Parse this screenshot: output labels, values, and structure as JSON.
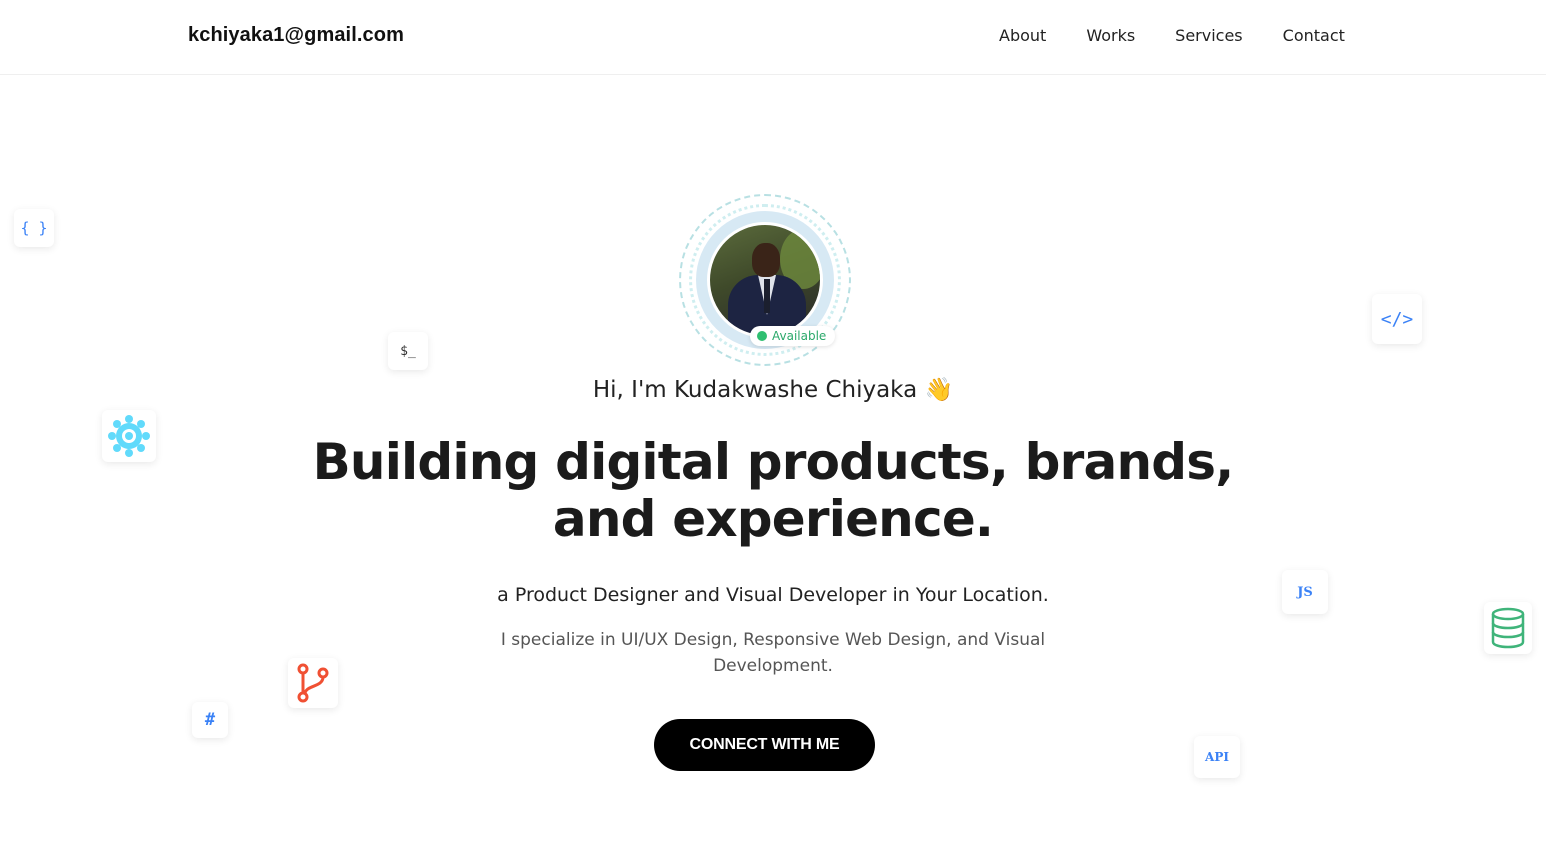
{
  "header": {
    "email": "kchiyaka1@gmail.com",
    "nav": [
      {
        "label": "About"
      },
      {
        "label": "Works"
      },
      {
        "label": "Services"
      },
      {
        "label": "Contact"
      }
    ]
  },
  "hero": {
    "status_badge": "Available",
    "greeting": "Hi, I'm Kudakwashe Chiyaka 👋",
    "headline_line1": "Building digital products, brands,",
    "headline_line2": "and experience.",
    "subtitle": "a Product Designer and Visual Developer in Your Location.",
    "description": "I specialize in UI/UX Design, Responsive Web Design, and Visual Development.",
    "cta_label": "CONNECT WITH ME"
  },
  "floating_icons": [
    {
      "name": "curly-braces-icon",
      "text": "{ }",
      "color": "#3b82f6"
    },
    {
      "name": "terminal-icon",
      "text": "$_",
      "color": "#333333"
    },
    {
      "name": "react-icon",
      "color": "#61dafb"
    },
    {
      "name": "git-branch-icon",
      "color": "#f05033"
    },
    {
      "name": "hash-icon",
      "text": "#",
      "color": "#3b82f6"
    },
    {
      "name": "code-tag-icon",
      "text": "</>",
      "color": "#3b82f6"
    },
    {
      "name": "javascript-icon",
      "text": "JS",
      "color": "#3b82f6"
    },
    {
      "name": "database-icon",
      "color": "#3fb47a"
    },
    {
      "name": "api-icon",
      "text": "API",
      "color": "#3b82f6"
    }
  ],
  "colors": {
    "accent_blue": "#3b82f6",
    "available_green": "#2fbf71",
    "cta_background": "#000000"
  }
}
